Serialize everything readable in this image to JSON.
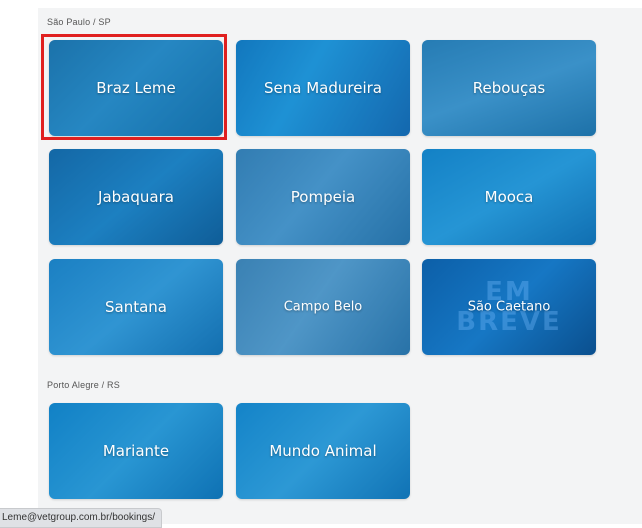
{
  "sections": [
    {
      "label": "São Paulo / SP",
      "cards": [
        {
          "label": "Braz Leme"
        },
        {
          "label": "Sena Madureira"
        },
        {
          "label": "Rebouças"
        },
        {
          "label": "Jabaquara"
        },
        {
          "label": "Pompeia"
        },
        {
          "label": "Mooca"
        },
        {
          "label": "Santana"
        },
        {
          "label": "Campo Belo"
        },
        {
          "label": "São Caetano",
          "watermark": "EM BREVE"
        }
      ]
    },
    {
      "label": "Porto Alegre / RS",
      "cards": [
        {
          "label": "Mariante"
        },
        {
          "label": "Mundo Animal"
        }
      ]
    }
  ],
  "status_bar": {
    "url": "Leme@vetgroup.com.br/bookings/"
  },
  "colors": {
    "card_tint": "#0a78c8",
    "selection": "#e02020",
    "panel": "#f3f4f5"
  }
}
